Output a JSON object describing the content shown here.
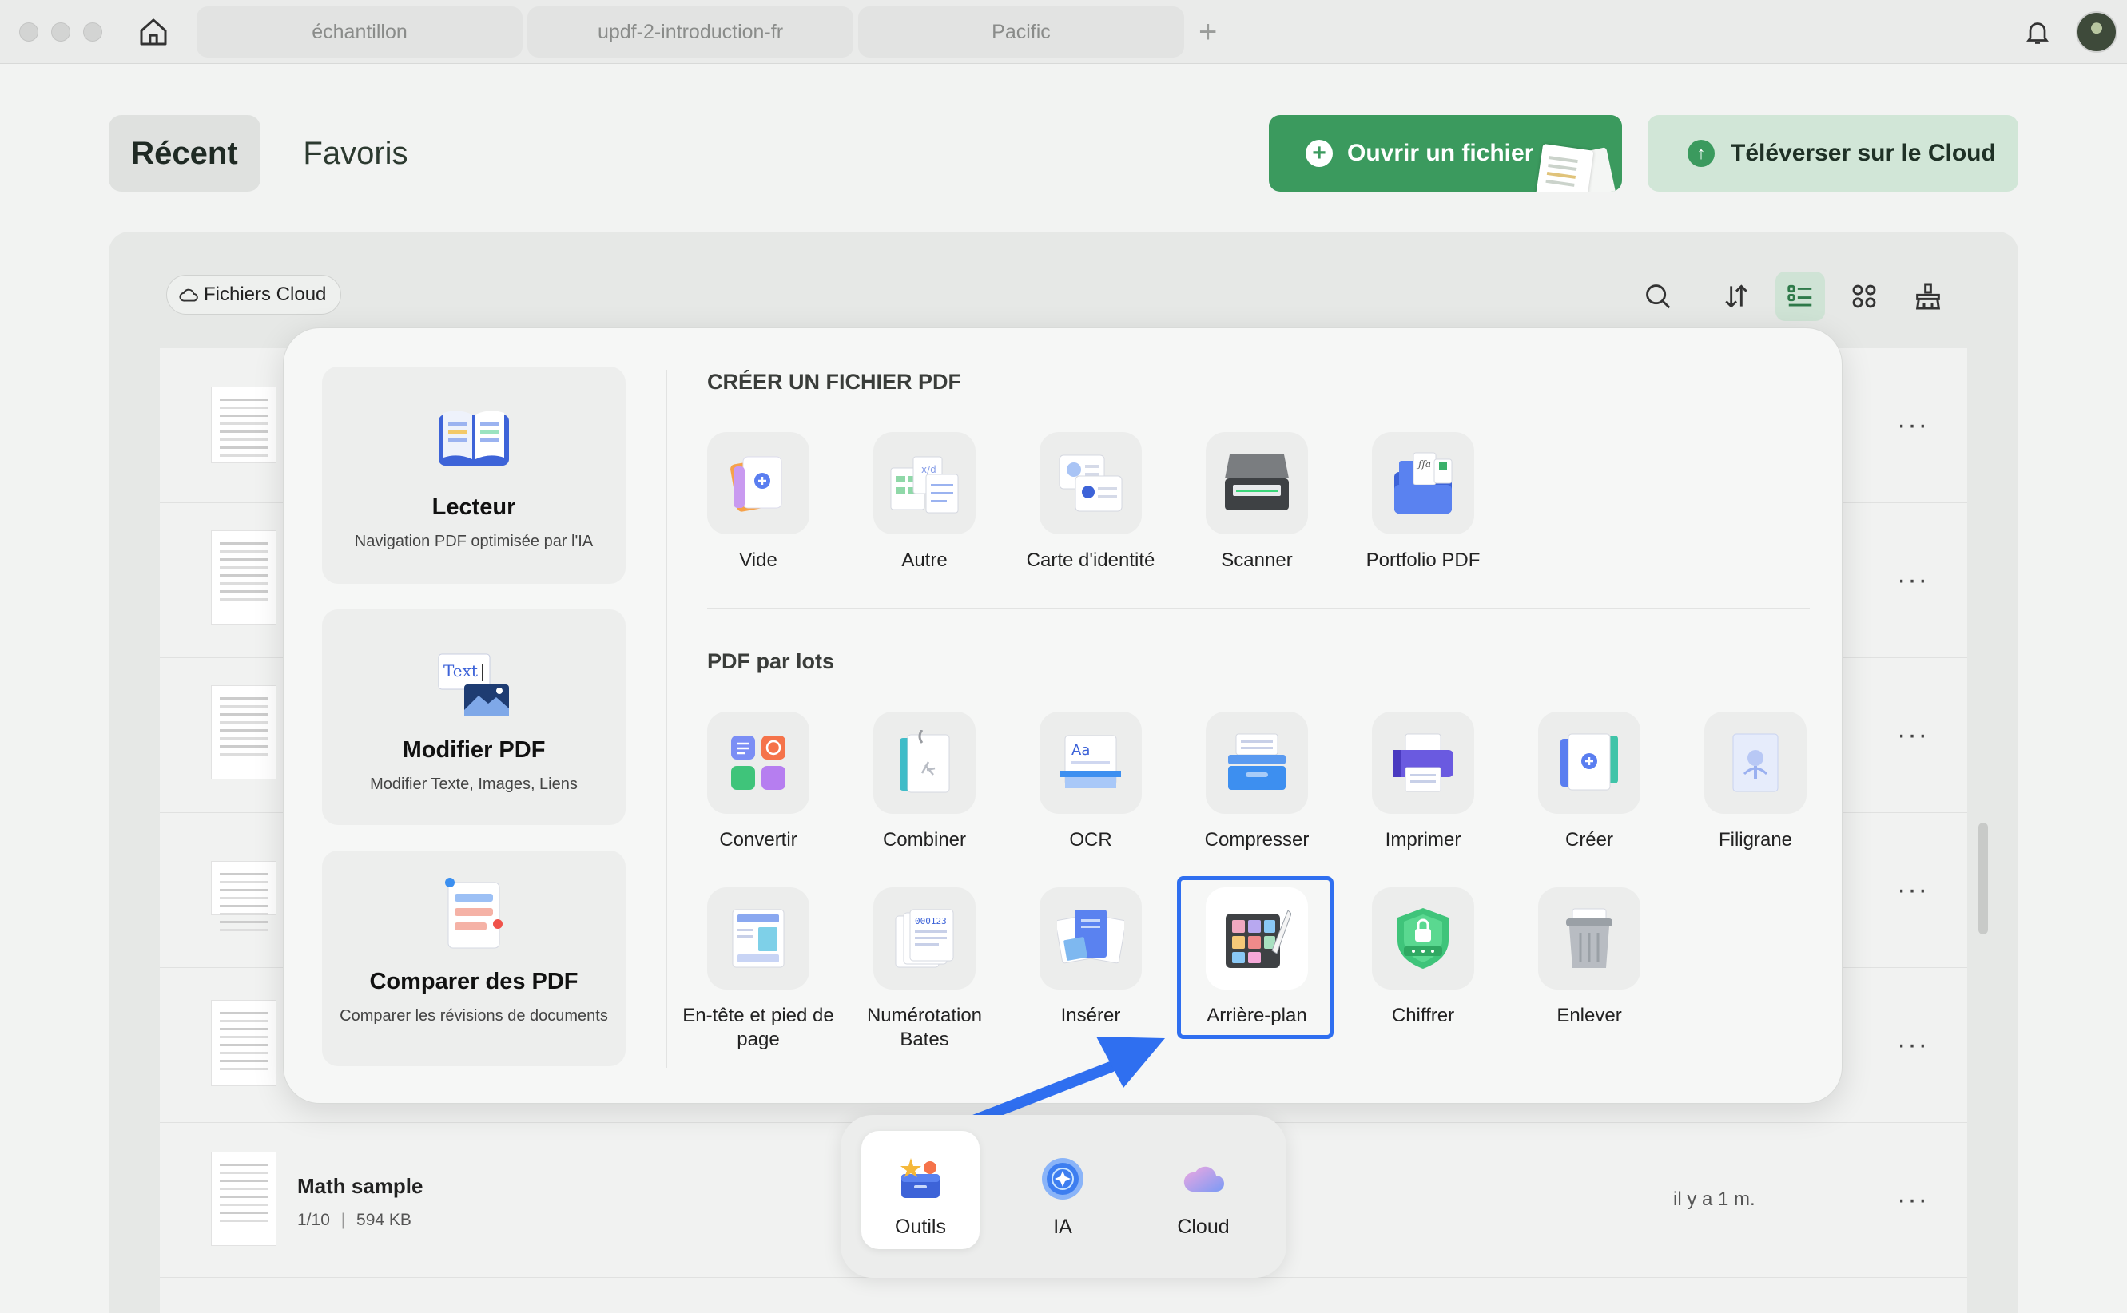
{
  "window": {
    "tabs": [
      {
        "label": "échantillon"
      },
      {
        "label": "updf-2-introduction-fr"
      },
      {
        "label": "Pacific"
      }
    ],
    "tab_add": "+"
  },
  "header": {
    "segment_recent": "Récent",
    "segment_favorites": "Favoris",
    "open_file_button": "Ouvrir un fichier",
    "upload_cloud_button": "Téléverser sur le Cloud"
  },
  "files": {
    "cloud_chip": "Fichiers Cloud",
    "more_label": "···",
    "last_file": {
      "name": "Math sample",
      "pages": "1/10",
      "size": "594 KB",
      "time": "il y a 1 m."
    }
  },
  "popup": {
    "cards": [
      {
        "title": "Lecteur",
        "subtitle": "Navigation PDF optimisée par l'IA"
      },
      {
        "title": "Modifier PDF",
        "subtitle": "Modifier Texte, Images, Liens"
      },
      {
        "title": "Comparer des PDF",
        "subtitle": "Comparer les révisions de documents"
      }
    ],
    "create_section": {
      "title": "CRÉER UN FICHIER PDF",
      "items": [
        {
          "label": "Vide",
          "icon": "blank-doc-icon"
        },
        {
          "label": "Autre",
          "icon": "other-doc-icon"
        },
        {
          "label": "Carte d'identité",
          "icon": "id-card-icon"
        },
        {
          "label": "Scanner",
          "icon": "scanner-icon"
        },
        {
          "label": "Portfolio PDF",
          "icon": "portfolio-icon"
        }
      ]
    },
    "batch_section": {
      "title": "PDF par lots",
      "items": [
        {
          "label": "Convertir",
          "icon": "convert-icon"
        },
        {
          "label": "Combiner",
          "icon": "combine-icon"
        },
        {
          "label": "OCR",
          "icon": "ocr-icon"
        },
        {
          "label": "Compresser",
          "icon": "compress-icon"
        },
        {
          "label": "Imprimer",
          "icon": "print-icon"
        },
        {
          "label": "Créer",
          "icon": "create-icon"
        },
        {
          "label": "Filigrane",
          "icon": "watermark-icon"
        },
        {
          "label": "En-tête et pied de page",
          "icon": "header-footer-icon"
        },
        {
          "label": "Numérotation Bates",
          "icon": "bates-icon"
        },
        {
          "label": "Insérer",
          "icon": "insert-icon"
        },
        {
          "label": "Arrière-plan",
          "icon": "background-icon"
        },
        {
          "label": "Chiffrer",
          "icon": "encrypt-icon"
        },
        {
          "label": "Enlever",
          "icon": "remove-icon"
        }
      ]
    }
  },
  "dock": {
    "tools": "Outils",
    "ai": "IA",
    "cloud": "Cloud"
  },
  "colors": {
    "accent_green": "#3b9a5e",
    "highlight_blue": "#2f6ff0"
  }
}
